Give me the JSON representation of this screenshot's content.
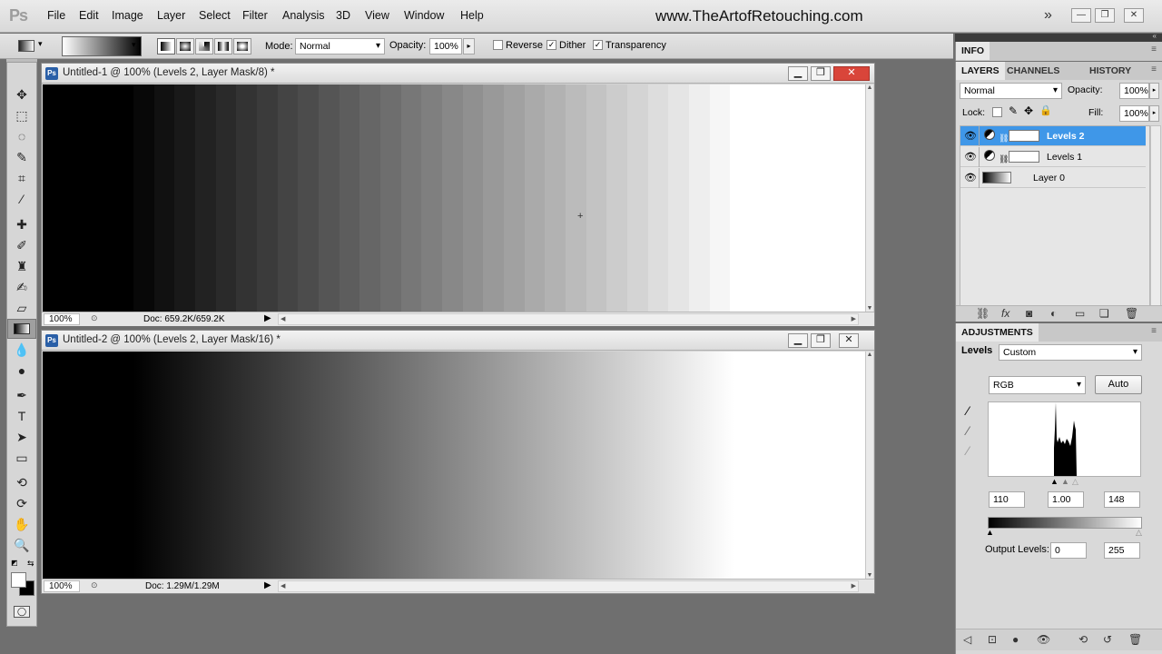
{
  "app": {
    "logo": "Ps",
    "website": "www.TheArtofRetouching.com"
  },
  "menu": [
    "File",
    "Edit",
    "Image",
    "Layer",
    "Select",
    "Filter",
    "Analysis",
    "3D",
    "View",
    "Window",
    "Help"
  ],
  "workspace_controls": {
    "more": "»",
    "minimize": "—",
    "restore": "❐",
    "close": "✕"
  },
  "options": {
    "mode_label": "Mode:",
    "mode_value": "Normal",
    "opacity_label": "Opacity:",
    "opacity_value": "100%",
    "reverse": "Reverse",
    "dither": "Dither",
    "transparency": "Transparency",
    "reverse_checked": false,
    "dither_checked": true,
    "transparency_checked": true
  },
  "documents": [
    {
      "title": "Untitled-1 @ 100% (Levels 2, Layer Mask/8) *",
      "zoom": "100%",
      "doc": "Doc: 659.2K/659.2K",
      "banded": true
    },
    {
      "title": "Untitled-2 @ 100% (Levels 2, Layer Mask/16) *",
      "zoom": "100%",
      "doc": "Doc: 1.29M/1.29M",
      "banded": false
    }
  ],
  "info_panel": {
    "tab": "INFO"
  },
  "layers_panel": {
    "tabs": [
      "LAYERS",
      "CHANNELS",
      "HISTORY"
    ],
    "blend_mode": "Normal",
    "opacity_label": "Opacity:",
    "opacity_value": "100%",
    "lock_label": "Lock:",
    "fill_label": "Fill:",
    "fill_value": "100%",
    "layers": [
      {
        "name": "Levels 2",
        "selected": true
      },
      {
        "name": "Levels 1",
        "selected": false
      },
      {
        "name": "Layer 0",
        "selected": false
      }
    ]
  },
  "adjustments_panel": {
    "tab": "ADJUSTMENTS",
    "type_label": "Levels",
    "preset": "Custom",
    "channel": "RGB",
    "auto_label": "Auto",
    "input_black": "110",
    "input_gamma": "1.00",
    "input_white": "148",
    "output_label": "Output Levels:",
    "output_black": "0",
    "output_white": "255"
  },
  "colors": {
    "selection_blue": "#3f97e8",
    "close_red": "#d9453a"
  }
}
